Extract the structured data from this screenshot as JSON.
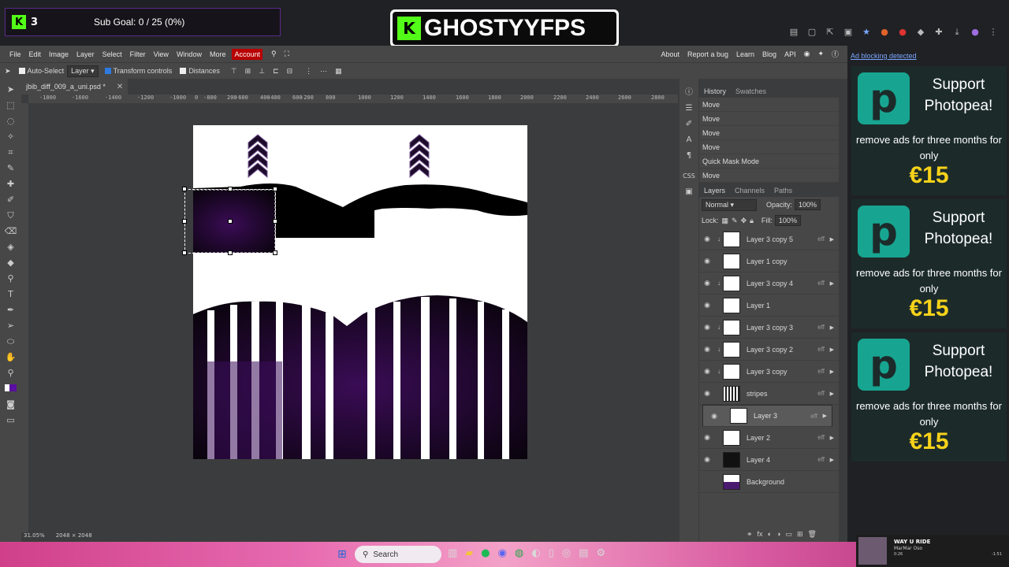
{
  "overlay": {
    "kick_logo": "K",
    "kick_count": "3",
    "sub_goal": "Sub Goal: 0 / 25 (0%)",
    "brand_k": "K",
    "brand_name": "GHOSTYYFPS"
  },
  "menubar": {
    "items": [
      "File",
      "Edit",
      "Image",
      "Layer",
      "Select",
      "Filter",
      "View",
      "Window",
      "More"
    ],
    "account": "Account",
    "right_items": [
      "About",
      "Report a bug",
      "Learn",
      "Blog",
      "API"
    ]
  },
  "options": {
    "auto_select": "Auto-Select",
    "auto_select_mode": "Layer",
    "transform_controls": "Transform controls",
    "distances": "Distances"
  },
  "document": {
    "tab_name": "jbib_diff_009_a_uni.psd *",
    "zoom": "31.05%",
    "size": "2048 × 2048"
  },
  "ruler_ticks": [
    "-1800",
    "-1600",
    "-1400",
    "-1200",
    "-1000",
    "-800",
    "-600",
    "-400",
    "-200",
    "0",
    "200",
    "400",
    "600",
    "800",
    "1000",
    "1200",
    "1400",
    "1600",
    "1800",
    "2000",
    "2200",
    "2400",
    "2600",
    "2800"
  ],
  "history": {
    "tabs": [
      "History",
      "Swatches"
    ],
    "items": [
      "Move",
      "Move",
      "Move",
      "Move",
      "Quick Mask Mode",
      "Move"
    ]
  },
  "layers_panel": {
    "tabs": [
      "Layers",
      "Channels",
      "Paths"
    ],
    "blend_mode": "Normal",
    "opacity_label": "Opacity:",
    "opacity": "100%",
    "lock_label": "Lock:",
    "fill_label": "Fill:",
    "fill": "100%",
    "eff_label": "eff",
    "layers": [
      {
        "name": "Layer 3 copy 5"
      },
      {
        "name": "Layer 1 copy"
      },
      {
        "name": "Layer 3 copy 4"
      },
      {
        "name": "Layer 1"
      },
      {
        "name": "Layer 3 copy 3"
      },
      {
        "name": "Layer 3 copy 2"
      },
      {
        "name": "Layer 3 copy"
      },
      {
        "name": "stripes"
      },
      {
        "name": "Layer 3"
      },
      {
        "name": "Layer 2"
      },
      {
        "name": "Layer 4"
      },
      {
        "name": "Background"
      }
    ]
  },
  "ad": {
    "blocking_notice": "Ad blocking detected",
    "title": "Support Photopea!",
    "sub": "remove ads for three months for only",
    "price": "€15"
  },
  "taskbar": {
    "search": "Search",
    "media_title": "WAY U RIDE",
    "media_artist": "MarMar Oso",
    "media_time": "0:26",
    "media_remaining": "-1:51"
  }
}
